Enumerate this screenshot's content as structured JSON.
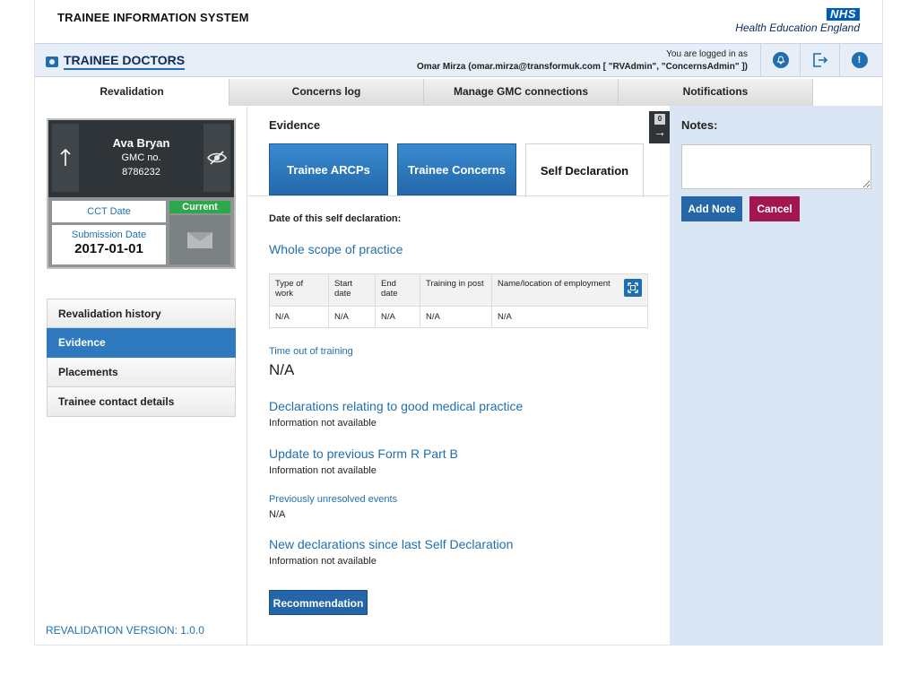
{
  "header": {
    "system_title": "TRAINEE INFORMATION SYSTEM",
    "nhs_logo": "NHS",
    "org_name": "Health Education England"
  },
  "topbar": {
    "brand": "TRAINEE DOCTORS",
    "login_prefix": "You are logged in as",
    "login_user": "Omar Mirza (omar.mirza@transformuk.com [ \"RVAdmin\", \"ConcernsAdmin\" ])",
    "icons": [
      "bell-icon",
      "logout-icon",
      "alert-icon"
    ]
  },
  "tabs": [
    {
      "label": "Revalidation",
      "active": true
    },
    {
      "label": "Concerns log",
      "active": false
    },
    {
      "label": "Manage GMC connections",
      "active": false
    },
    {
      "label": "Notifications",
      "active": false
    }
  ],
  "trainee_card": {
    "name": "Ava Bryan",
    "gmc_label": "GMC no.",
    "gmc_number": "8786232",
    "cct_label": "CCT Date",
    "submission_label": "Submission Date",
    "submission_date": "2017-01-01",
    "status": "Current"
  },
  "side_menu": [
    {
      "label": "Revalidation history",
      "active": false
    },
    {
      "label": "Evidence",
      "active": true
    },
    {
      "label": "Placements",
      "active": false
    },
    {
      "label": "Trainee contact details",
      "active": false
    }
  ],
  "version": "REVALIDATION VERSION: 1.0.0",
  "evidence": {
    "title": "Evidence",
    "subtabs": [
      {
        "label": "Trainee ARCPs",
        "active": false
      },
      {
        "label": "Trainee Concerns",
        "active": false
      },
      {
        "label": "Self Declaration",
        "active": true
      }
    ],
    "expander_count": "0",
    "date_label": "Date of this self declaration:",
    "scope_heading": "Whole scope of practice",
    "table": {
      "headers": [
        "Type of work",
        "Start date",
        "End date",
        "Training in post",
        "Name/location of employment"
      ],
      "rows": [
        [
          "N/A",
          "N/A",
          "N/A",
          "N/A",
          "N/A"
        ]
      ]
    },
    "time_out_label": "Time out of training",
    "time_out_value": "N/A",
    "good_practice_heading": "Declarations relating to good medical practice",
    "good_practice_value": "Information not available",
    "form_r_heading": "Update to previous Form R Part B",
    "form_r_value": "Information not available",
    "unresolved_label": "Previously unresolved events",
    "unresolved_value": "N/A",
    "new_decl_heading": "New declarations since last Self Declaration",
    "new_decl_value": "Information not available",
    "recommendation_button": "Recommendation"
  },
  "notes": {
    "title": "Notes:",
    "value": "",
    "add_button": "Add Note",
    "cancel_button": "Cancel"
  }
}
